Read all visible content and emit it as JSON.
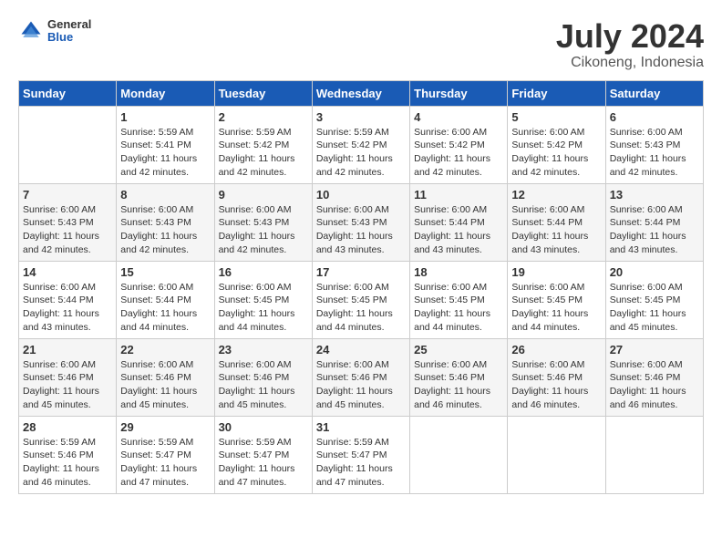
{
  "header": {
    "logo": {
      "general": "General",
      "blue": "Blue"
    },
    "title": "July 2024",
    "location": "Cikoneng, Indonesia"
  },
  "weekdays": [
    "Sunday",
    "Monday",
    "Tuesday",
    "Wednesday",
    "Thursday",
    "Friday",
    "Saturday"
  ],
  "weeks": [
    [
      {
        "day": "",
        "sunrise": "",
        "sunset": "",
        "daylight": ""
      },
      {
        "day": "1",
        "sunrise": "Sunrise: 5:59 AM",
        "sunset": "Sunset: 5:41 PM",
        "daylight": "Daylight: 11 hours and 42 minutes."
      },
      {
        "day": "2",
        "sunrise": "Sunrise: 5:59 AM",
        "sunset": "Sunset: 5:42 PM",
        "daylight": "Daylight: 11 hours and 42 minutes."
      },
      {
        "day": "3",
        "sunrise": "Sunrise: 5:59 AM",
        "sunset": "Sunset: 5:42 PM",
        "daylight": "Daylight: 11 hours and 42 minutes."
      },
      {
        "day": "4",
        "sunrise": "Sunrise: 6:00 AM",
        "sunset": "Sunset: 5:42 PM",
        "daylight": "Daylight: 11 hours and 42 minutes."
      },
      {
        "day": "5",
        "sunrise": "Sunrise: 6:00 AM",
        "sunset": "Sunset: 5:42 PM",
        "daylight": "Daylight: 11 hours and 42 minutes."
      },
      {
        "day": "6",
        "sunrise": "Sunrise: 6:00 AM",
        "sunset": "Sunset: 5:43 PM",
        "daylight": "Daylight: 11 hours and 42 minutes."
      }
    ],
    [
      {
        "day": "7",
        "sunrise": "Sunrise: 6:00 AM",
        "sunset": "Sunset: 5:43 PM",
        "daylight": "Daylight: 11 hours and 42 minutes."
      },
      {
        "day": "8",
        "sunrise": "Sunrise: 6:00 AM",
        "sunset": "Sunset: 5:43 PM",
        "daylight": "Daylight: 11 hours and 42 minutes."
      },
      {
        "day": "9",
        "sunrise": "Sunrise: 6:00 AM",
        "sunset": "Sunset: 5:43 PM",
        "daylight": "Daylight: 11 hours and 42 minutes."
      },
      {
        "day": "10",
        "sunrise": "Sunrise: 6:00 AM",
        "sunset": "Sunset: 5:43 PM",
        "daylight": "Daylight: 11 hours and 43 minutes."
      },
      {
        "day": "11",
        "sunrise": "Sunrise: 6:00 AM",
        "sunset": "Sunset: 5:44 PM",
        "daylight": "Daylight: 11 hours and 43 minutes."
      },
      {
        "day": "12",
        "sunrise": "Sunrise: 6:00 AM",
        "sunset": "Sunset: 5:44 PM",
        "daylight": "Daylight: 11 hours and 43 minutes."
      },
      {
        "day": "13",
        "sunrise": "Sunrise: 6:00 AM",
        "sunset": "Sunset: 5:44 PM",
        "daylight": "Daylight: 11 hours and 43 minutes."
      }
    ],
    [
      {
        "day": "14",
        "sunrise": "Sunrise: 6:00 AM",
        "sunset": "Sunset: 5:44 PM",
        "daylight": "Daylight: 11 hours and 43 minutes."
      },
      {
        "day": "15",
        "sunrise": "Sunrise: 6:00 AM",
        "sunset": "Sunset: 5:44 PM",
        "daylight": "Daylight: 11 hours and 44 minutes."
      },
      {
        "day": "16",
        "sunrise": "Sunrise: 6:00 AM",
        "sunset": "Sunset: 5:45 PM",
        "daylight": "Daylight: 11 hours and 44 minutes."
      },
      {
        "day": "17",
        "sunrise": "Sunrise: 6:00 AM",
        "sunset": "Sunset: 5:45 PM",
        "daylight": "Daylight: 11 hours and 44 minutes."
      },
      {
        "day": "18",
        "sunrise": "Sunrise: 6:00 AM",
        "sunset": "Sunset: 5:45 PM",
        "daylight": "Daylight: 11 hours and 44 minutes."
      },
      {
        "day": "19",
        "sunrise": "Sunrise: 6:00 AM",
        "sunset": "Sunset: 5:45 PM",
        "daylight": "Daylight: 11 hours and 44 minutes."
      },
      {
        "day": "20",
        "sunrise": "Sunrise: 6:00 AM",
        "sunset": "Sunset: 5:45 PM",
        "daylight": "Daylight: 11 hours and 45 minutes."
      }
    ],
    [
      {
        "day": "21",
        "sunrise": "Sunrise: 6:00 AM",
        "sunset": "Sunset: 5:46 PM",
        "daylight": "Daylight: 11 hours and 45 minutes."
      },
      {
        "day": "22",
        "sunrise": "Sunrise: 6:00 AM",
        "sunset": "Sunset: 5:46 PM",
        "daylight": "Daylight: 11 hours and 45 minutes."
      },
      {
        "day": "23",
        "sunrise": "Sunrise: 6:00 AM",
        "sunset": "Sunset: 5:46 PM",
        "daylight": "Daylight: 11 hours and 45 minutes."
      },
      {
        "day": "24",
        "sunrise": "Sunrise: 6:00 AM",
        "sunset": "Sunset: 5:46 PM",
        "daylight": "Daylight: 11 hours and 45 minutes."
      },
      {
        "day": "25",
        "sunrise": "Sunrise: 6:00 AM",
        "sunset": "Sunset: 5:46 PM",
        "daylight": "Daylight: 11 hours and 46 minutes."
      },
      {
        "day": "26",
        "sunrise": "Sunrise: 6:00 AM",
        "sunset": "Sunset: 5:46 PM",
        "daylight": "Daylight: 11 hours and 46 minutes."
      },
      {
        "day": "27",
        "sunrise": "Sunrise: 6:00 AM",
        "sunset": "Sunset: 5:46 PM",
        "daylight": "Daylight: 11 hours and 46 minutes."
      }
    ],
    [
      {
        "day": "28",
        "sunrise": "Sunrise: 5:59 AM",
        "sunset": "Sunset: 5:46 PM",
        "daylight": "Daylight: 11 hours and 46 minutes."
      },
      {
        "day": "29",
        "sunrise": "Sunrise: 5:59 AM",
        "sunset": "Sunset: 5:47 PM",
        "daylight": "Daylight: 11 hours and 47 minutes."
      },
      {
        "day": "30",
        "sunrise": "Sunrise: 5:59 AM",
        "sunset": "Sunset: 5:47 PM",
        "daylight": "Daylight: 11 hours and 47 minutes."
      },
      {
        "day": "31",
        "sunrise": "Sunrise: 5:59 AM",
        "sunset": "Sunset: 5:47 PM",
        "daylight": "Daylight: 11 hours and 47 minutes."
      },
      {
        "day": "",
        "sunrise": "",
        "sunset": "",
        "daylight": ""
      },
      {
        "day": "",
        "sunrise": "",
        "sunset": "",
        "daylight": ""
      },
      {
        "day": "",
        "sunrise": "",
        "sunset": "",
        "daylight": ""
      }
    ]
  ]
}
